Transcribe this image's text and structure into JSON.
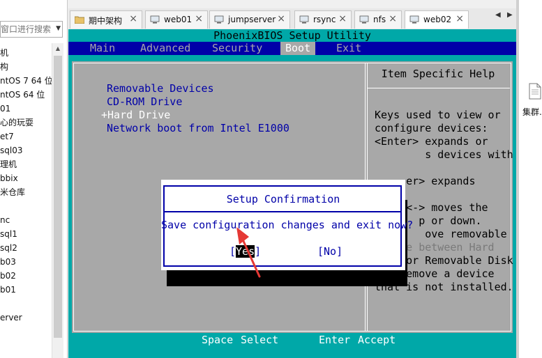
{
  "sidebar": {
    "search_placeholder": "窗口进行搜索",
    "items": [
      "机",
      "构",
      "ntOS 7 64 位",
      "ntOS 64 位",
      "01",
      "心的玩耍",
      "et7",
      "sql03",
      "理机",
      "bbix",
      "米仓库",
      "",
      "nc",
      "sql1",
      "sql2",
      "b03",
      "b02",
      "b01",
      "",
      "erver"
    ]
  },
  "tabs": [
    {
      "label": "期中架构",
      "icon": "folder-icon"
    },
    {
      "label": "web01",
      "icon": "vm-icon"
    },
    {
      "label": "jumpserver",
      "icon": "vm-icon"
    },
    {
      "label": "rsync",
      "icon": "vm-icon"
    },
    {
      "label": "nfs",
      "icon": "vm-icon"
    },
    {
      "label": "web02",
      "icon": "vm-icon"
    }
  ],
  "bios": {
    "title": "PhoenixBIOS Setup Utility",
    "menu": [
      "Main",
      "Advanced",
      "Security",
      "Boot",
      "Exit"
    ],
    "active_menu": "Boot",
    "boot_order": [
      "Removable Devices",
      "CD-ROM Drive",
      "+Hard Drive",
      "Network boot from Intel E1000"
    ],
    "help_title": "Item Specific Help",
    "help_lines": [
      "Keys used to view or",
      "configure devices:",
      "<Enter> expands or",
      "        s devices with",
      "",
      "     er> expands",
      "",
      "     <-> moves the",
      "       p or down.",
      "        ove removable",
      "device between Hard",
      "Disk or Removable Disk",
      "<d> Remove a device",
      "that is not installed."
    ],
    "dialog": {
      "title": "Setup Confirmation",
      "message": "Save configuration changes and exit now?",
      "yes_open": "[",
      "yes_label": "Yes",
      "yes_close": "]",
      "no_label": "[No]"
    },
    "footer": {
      "key1": "Space",
      "action1": "Select",
      "key2": "Enter",
      "action2": "Accept"
    }
  },
  "desktop": {
    "file_label": "集群."
  },
  "colors": {
    "bios_cyan": "#00a8a8",
    "bios_blue": "#0000a8",
    "bios_gray": "#a8a8a8",
    "annotation_red": "#e53935"
  }
}
